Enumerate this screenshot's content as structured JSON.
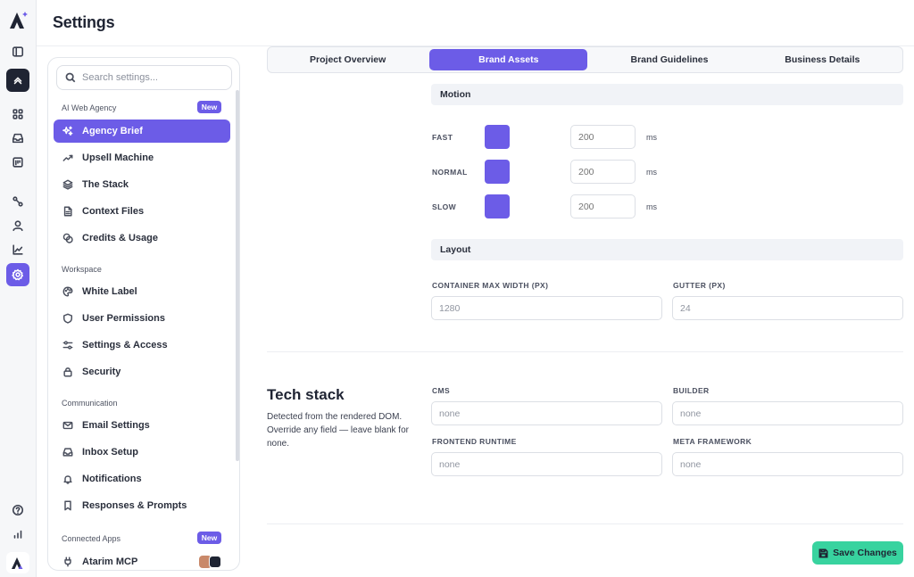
{
  "header": {
    "title": "Settings"
  },
  "rail": {
    "items": [
      {
        "name": "sidebar-toggle-icon"
      },
      {
        "name": "collapse-up-icon"
      },
      {
        "name": "grid-icon"
      },
      {
        "name": "inbox-icon"
      },
      {
        "name": "calendar-icon"
      },
      {
        "name": "workflow-icon"
      },
      {
        "name": "user-icon"
      },
      {
        "name": "chart-icon"
      },
      {
        "name": "settings-gear-icon"
      },
      {
        "name": "help-icon"
      },
      {
        "name": "bar-chart-icon"
      }
    ]
  },
  "sidebar": {
    "search_placeholder": "Search settings...",
    "groups": {
      "ai": {
        "label": "AI Web Agency",
        "badge": "New"
      },
      "workspace": {
        "label": "Workspace"
      },
      "communication": {
        "label": "Communication"
      },
      "connected": {
        "label": "Connected Apps",
        "badge": "New"
      }
    },
    "items": {
      "agency_brief": "Agency Brief",
      "upsell_machine": "Upsell Machine",
      "the_stack": "The Stack",
      "context_files": "Context Files",
      "credits_usage": "Credits & Usage",
      "white_label": "White Label",
      "user_permissions": "User Permissions",
      "settings_access": "Settings & Access",
      "security": "Security",
      "email_settings": "Email Settings",
      "inbox_setup": "Inbox Setup",
      "notifications": "Notifications",
      "responses_prompts": "Responses & Prompts",
      "atarim_mcp": "Atarim MCP"
    },
    "active_item": "Agency Brief"
  },
  "tabs": [
    "Project Overview",
    "Brand Assets",
    "Brand Guidelines",
    "Business Details"
  ],
  "active_tab": "Brand Assets",
  "motion": {
    "title": "Motion",
    "unit": "ms",
    "swatch_color": "#6c5ce7",
    "rows": [
      {
        "label": "FAST",
        "placeholder": "200"
      },
      {
        "label": "NORMAL",
        "placeholder": "200"
      },
      {
        "label": "SLOW",
        "placeholder": "200"
      }
    ]
  },
  "layout": {
    "title": "Layout",
    "container_label": "CONTAINER MAX WIDTH (PX)",
    "container_placeholder": "1280",
    "gutter_label": "GUTTER (PX)",
    "gutter_placeholder": "24"
  },
  "tech_stack": {
    "title": "Tech stack",
    "description": "Detected from the rendered DOM. Override any field — leave blank for none.",
    "cms_label": "CMS",
    "cms_placeholder": "none",
    "builder_label": "BUILDER",
    "builder_placeholder": "none",
    "frontend_label": "FRONTEND RUNTIME",
    "frontend_placeholder": "none",
    "meta_label": "META FRAMEWORK",
    "meta_placeholder": "none"
  },
  "footer": {
    "save_label": "Save Changes"
  },
  "colors": {
    "accent": "#6c5ce7",
    "save": "#38d39f",
    "dark": "#1f2433"
  }
}
